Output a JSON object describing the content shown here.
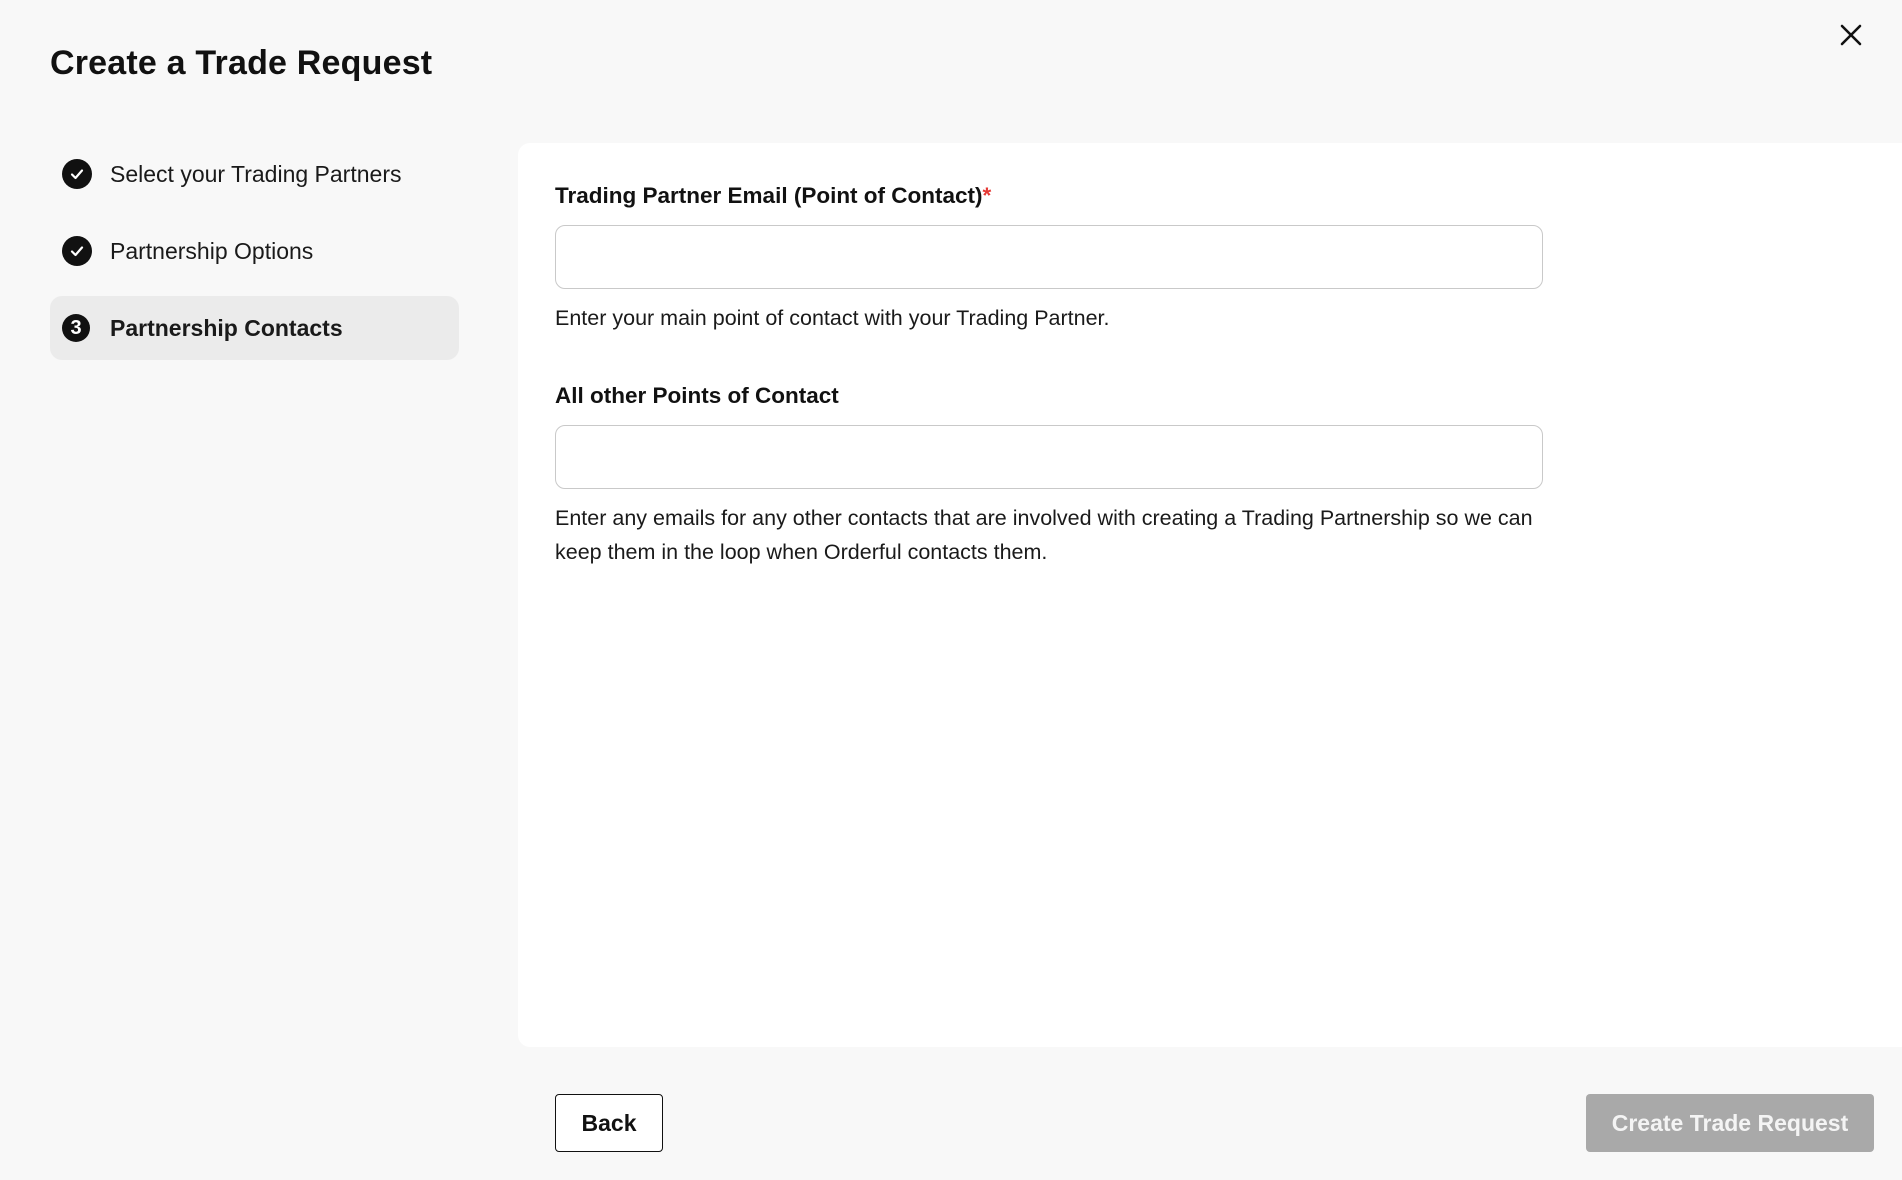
{
  "dialog": {
    "title": "Create a Trade Request",
    "close_icon": "close-icon"
  },
  "steps": [
    {
      "label": "Select your Trading Partners",
      "status": "complete",
      "icon": "check-circle-icon"
    },
    {
      "label": "Partnership Options",
      "status": "complete",
      "icon": "check-circle-icon"
    },
    {
      "label": "Partnership Contacts",
      "status": "active",
      "number": "3"
    }
  ],
  "form": {
    "primary_email": {
      "label": "Trading Partner Email (Point of Contact)",
      "required_marker": "*",
      "value": "",
      "help": "Enter your main point of contact with your Trading Partner."
    },
    "other_contacts": {
      "label": "All other Points of Contact",
      "value": "",
      "help": "Enter any emails for any other contacts that are involved with creating a Trading Partnership so we can keep them in the loop when Orderful contacts them."
    }
  },
  "footer": {
    "back_label": "Back",
    "create_label": "Create Trade Request",
    "create_disabled": true
  },
  "colors": {
    "background": "#f8f8f8",
    "panel": "#ffffff",
    "active_step": "#ebebeb",
    "required": "#e53935",
    "disabled_button": "#a9a9a9"
  }
}
